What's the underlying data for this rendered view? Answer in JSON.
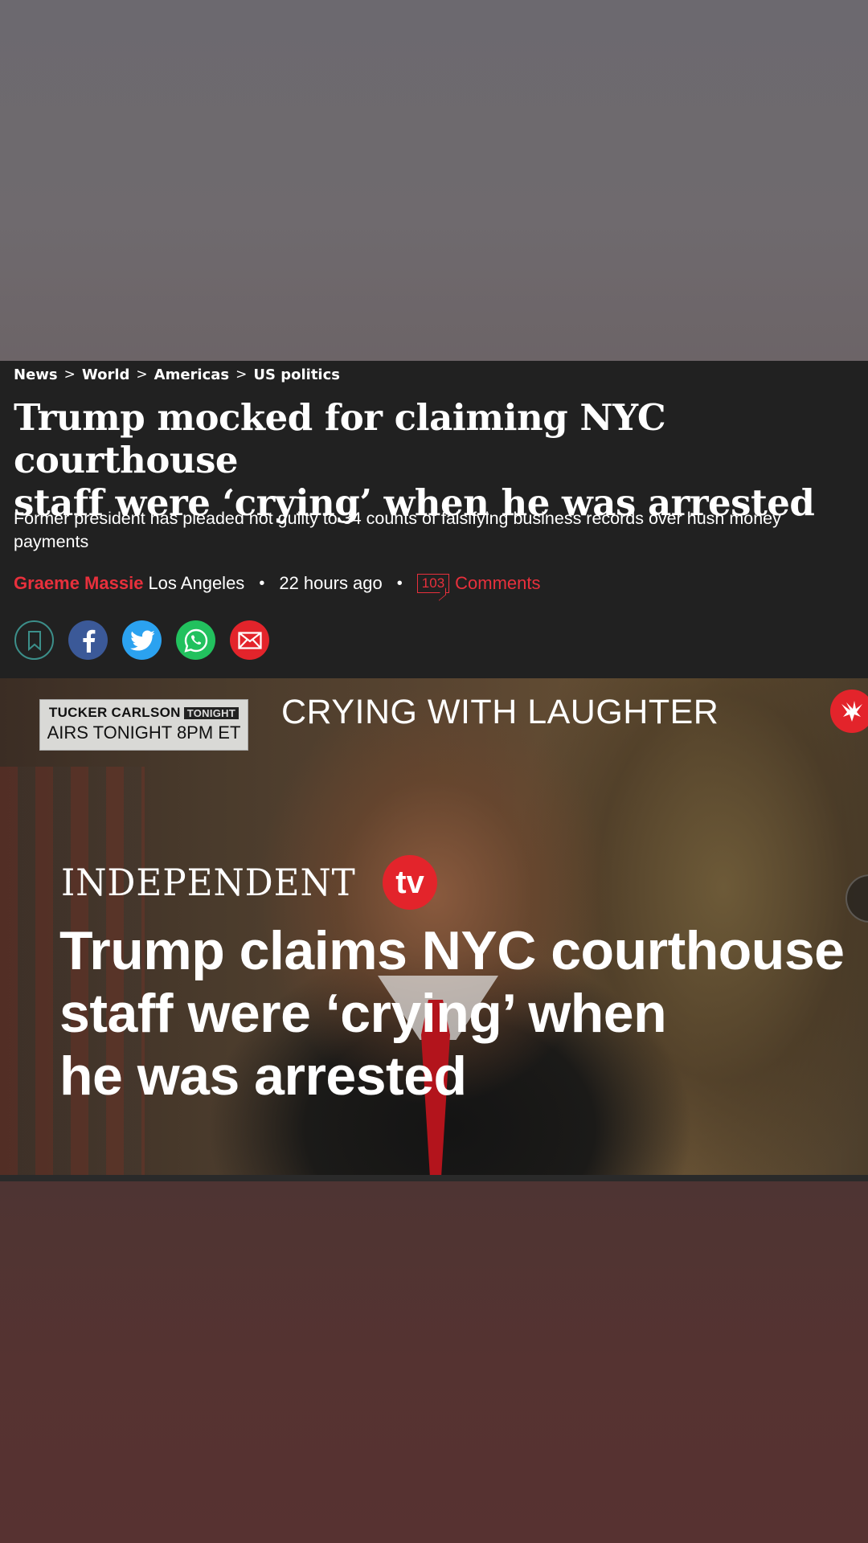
{
  "breadcrumb": {
    "items": [
      "News",
      "World",
      "Americas",
      "US politics"
    ],
    "separator": ">"
  },
  "article": {
    "headline_line1": "Trump mocked for claiming NYC courthouse",
    "headline_line2": "staff were ‘crying’ when he was arrested",
    "standfirst": "Former president has pleaded not guilty to 34 counts of falsifying business records over hush money payments",
    "author": "Graeme Massie",
    "location": "Los Angeles",
    "time": "22 hours ago",
    "comment_count": "103",
    "comments_label": "Comments",
    "dot": "•"
  },
  "share": {
    "icons": [
      "bookmark-icon",
      "facebook-icon",
      "twitter-icon",
      "whatsapp-icon",
      "email-icon"
    ]
  },
  "video": {
    "badge_line1": "TUCKER CARLSON",
    "badge_tonight": "TONIGHT",
    "badge_line2": "AIRS TONIGHT 8PM ET",
    "overlay_title": "CRYING WITH LAUGHTER",
    "brand_word": "INDEPENDENT",
    "brand_tv": "tv",
    "headline_line1": "Trump claims NYC courthouse",
    "headline_line2": "staff were ‘crying’ when",
    "headline_line3": "he was arrested"
  },
  "colors": {
    "accent": "#e8303c",
    "background": "#212121",
    "facebook": "#3b5998",
    "twitter": "#2ba2f0",
    "whatsapp": "#22c15e",
    "email": "#e3242b"
  }
}
